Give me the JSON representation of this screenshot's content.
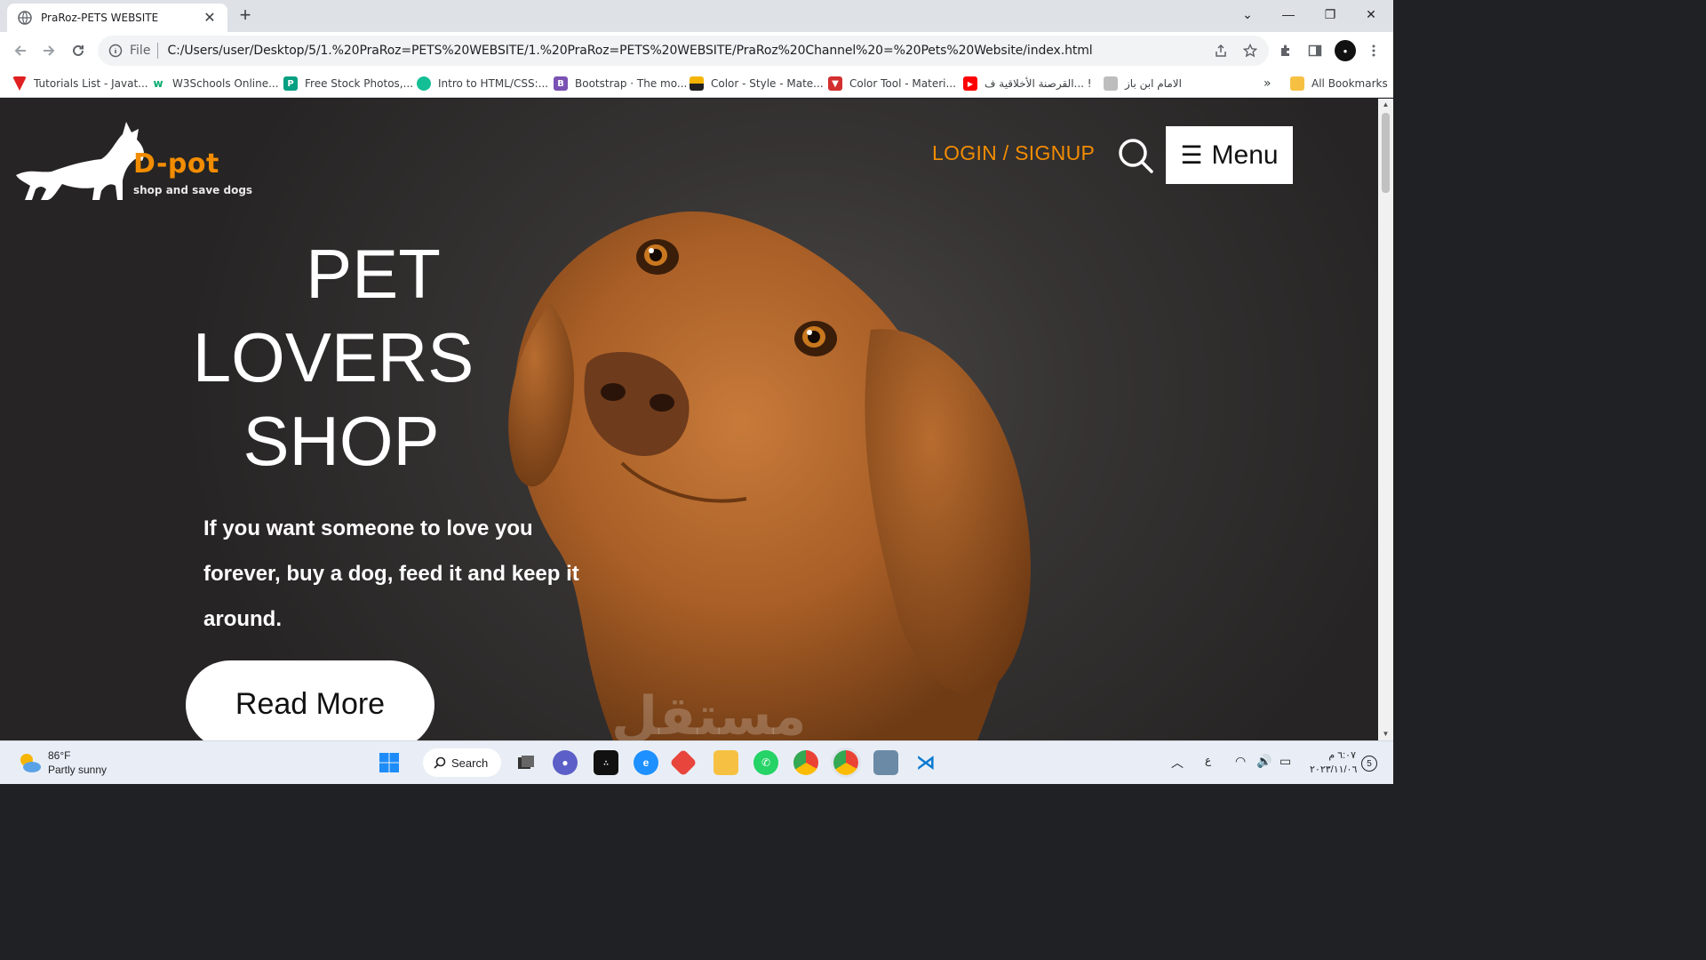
{
  "browser": {
    "tab_title": "PraRoz-PETS WEBSITE",
    "address_scheme": "File",
    "address_url": "C:/Users/user/Desktop/5/1.%20PraRoz=PETS%20WEBSITE/1.%20PraRoz=PETS%20WEBSITE/PraRoz%20Channel%20=%20Pets%20Website/index.html",
    "bookmarks": [
      {
        "label": "Tutorials List - Javat...",
        "icon": "javatpoint-icon",
        "color": "#e02020"
      },
      {
        "label": "W3Schools Online...",
        "icon": "w3schools-icon",
        "color": "#04aa6d"
      },
      {
        "label": "Free Stock Photos,...",
        "icon": "pexels-icon",
        "color": "#05a081"
      },
      {
        "label": "Intro to HTML/CSS:...",
        "icon": "khan-academy-icon",
        "color": "#14bf96"
      },
      {
        "label": "Bootstrap · The mo...",
        "icon": "bootstrap-icon",
        "color": "#7952b3"
      },
      {
        "label": "Color - Style - Mate...",
        "icon": "material-icon",
        "color": "#f4b400"
      },
      {
        "label": "Color Tool - Materi...",
        "icon": "material-tool-icon",
        "color": "#d32f2f"
      },
      {
        "label": "القرصنة الأخلاقية ف... !",
        "icon": "youtube-icon",
        "color": "#ff0000"
      },
      {
        "label": "الامام ابن باز",
        "icon": "site-icon",
        "color": "#9e9e9e"
      }
    ],
    "bookmarks_overflow": "»",
    "all_bookmarks": "All Bookmarks"
  },
  "site": {
    "brand": "D-pot",
    "tagline": "shop and save dogs",
    "login_label": "LOGIN / SIGNUP",
    "menu_label": "Menu",
    "hero_title_lines": [
      "PET",
      "LOVERS",
      "SHOP"
    ],
    "hero_text": "If you want someone to love you forever, buy a dog, feed it and keep it around.",
    "read_more": "Read More",
    "watermark": "مستقل",
    "brand_color": "#f28c00"
  },
  "taskbar": {
    "temperature": "86°F",
    "weather": "Partly sunny",
    "search_label": "Search",
    "lang": "ع",
    "time": "٦:٠٧ م",
    "date": "٢٠٢٣/١١/٠٦",
    "notifications": "5"
  }
}
